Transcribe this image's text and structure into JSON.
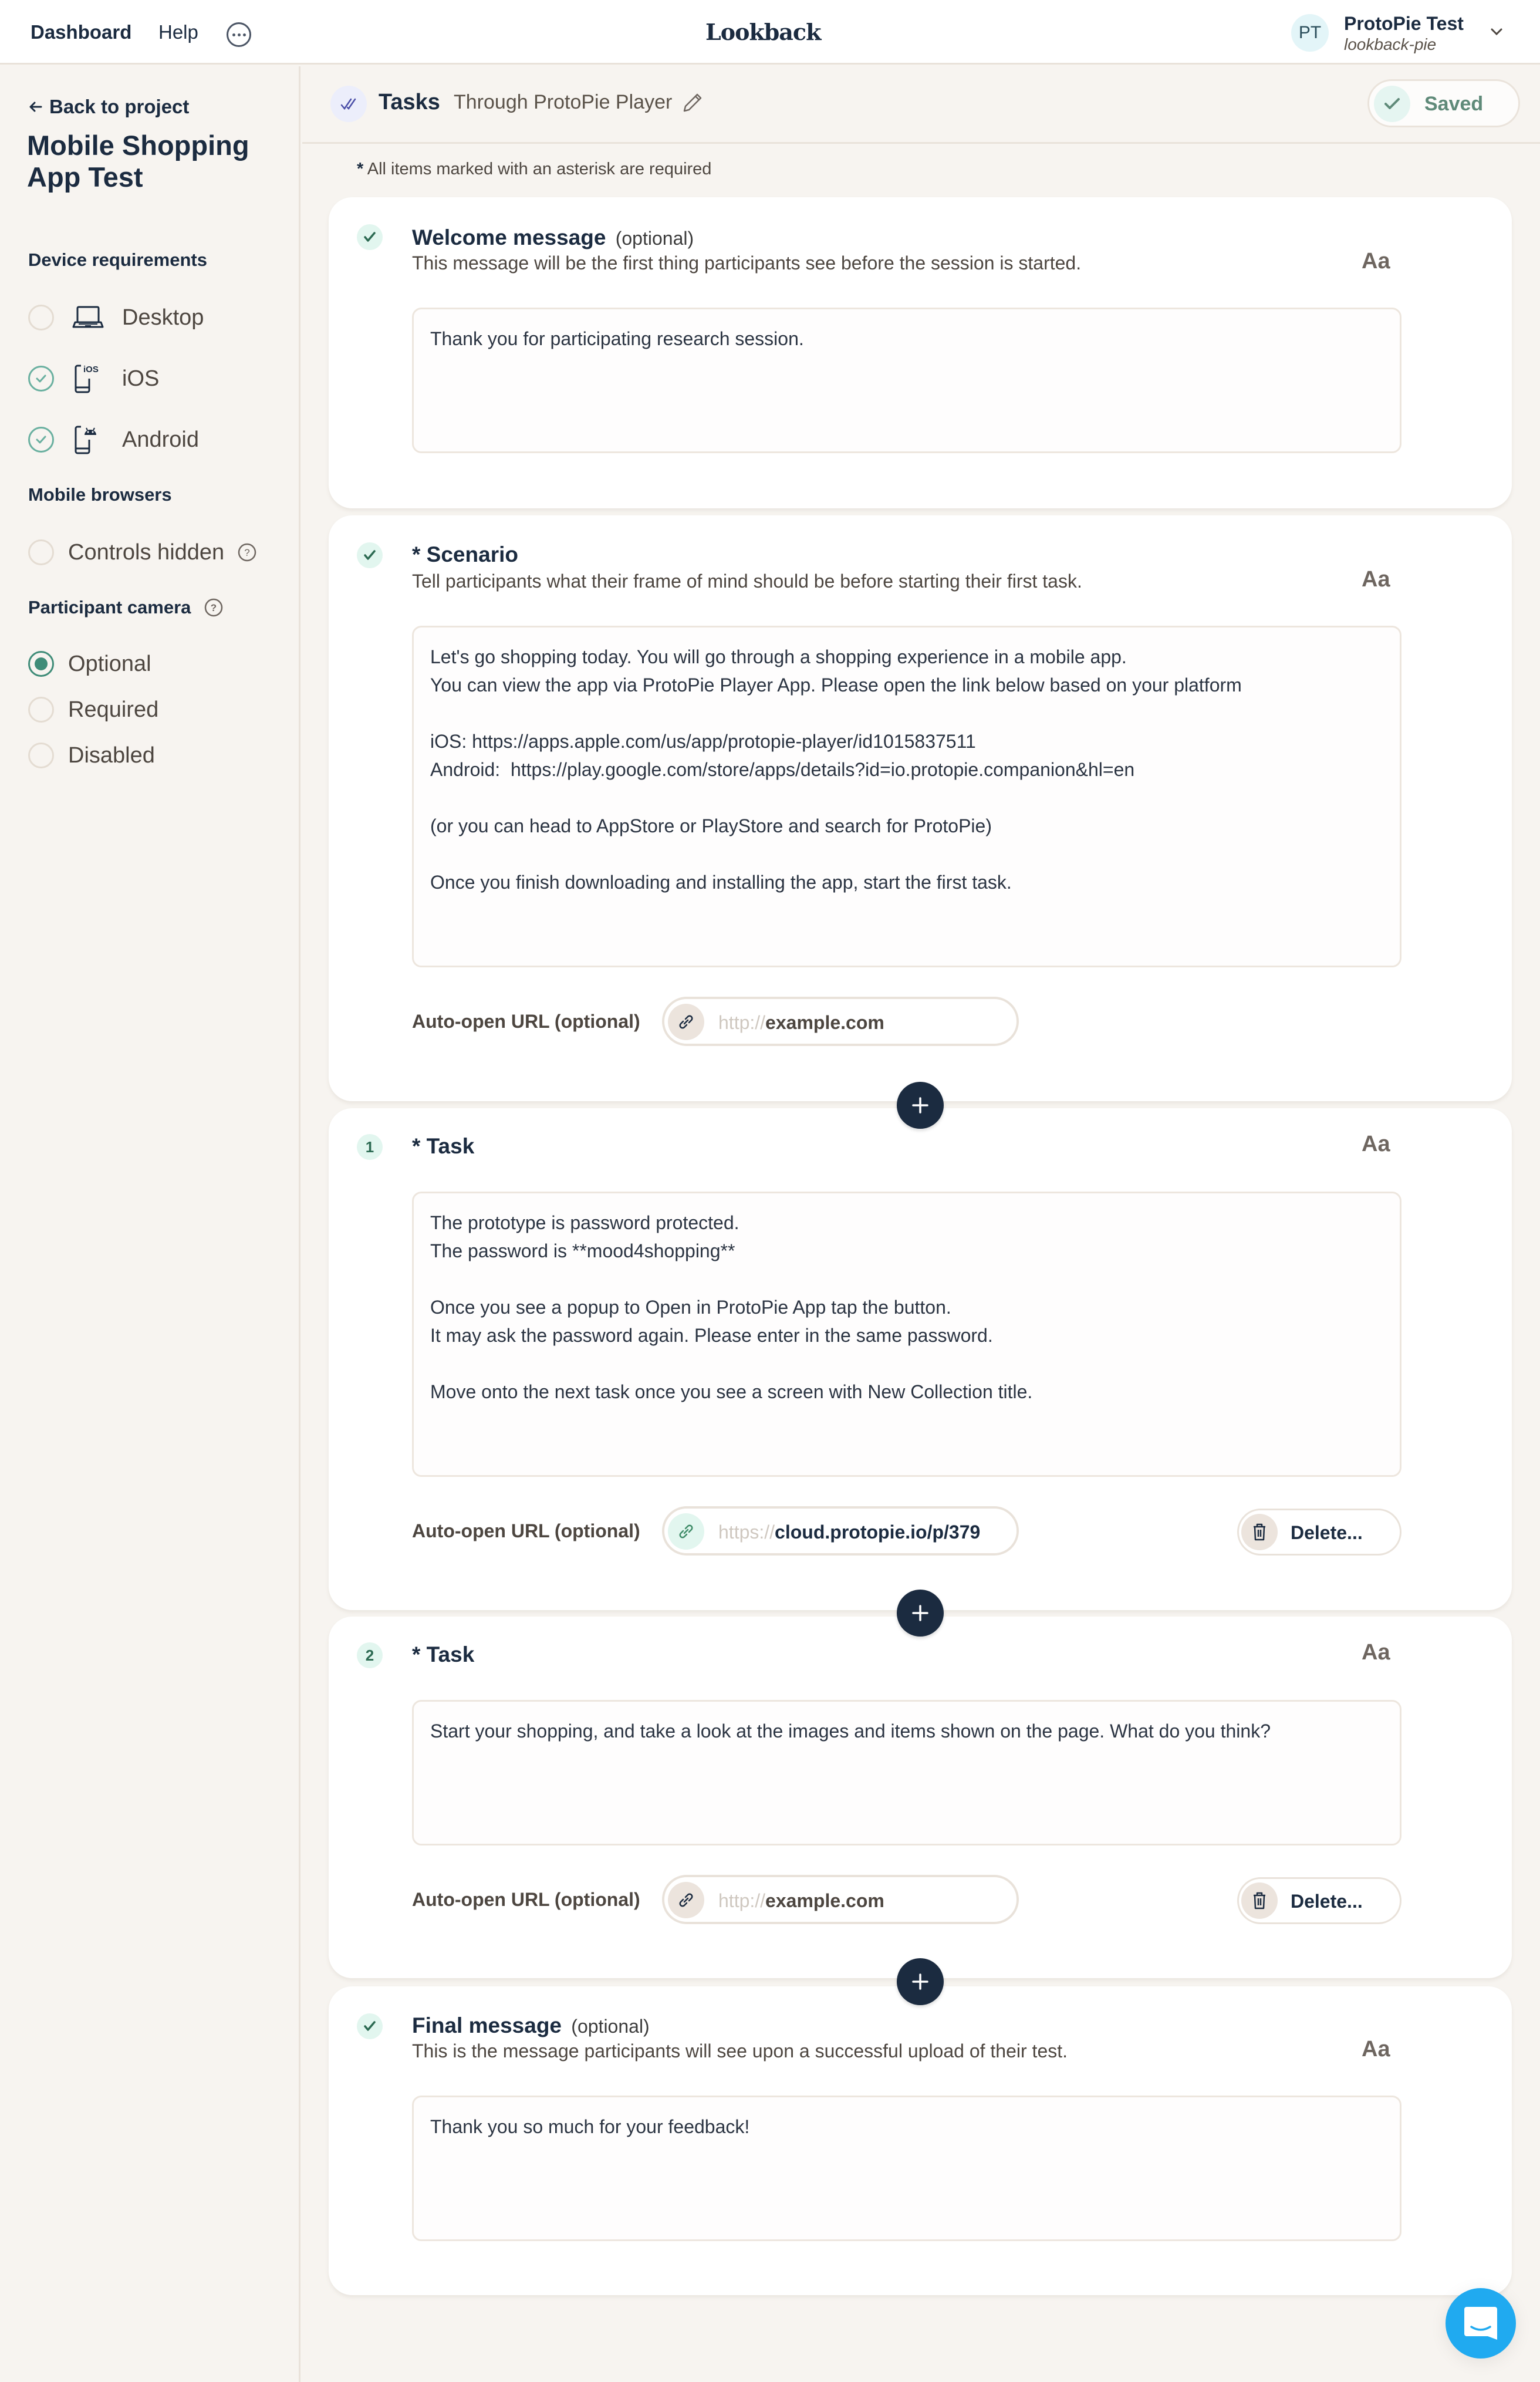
{
  "topbar": {
    "nav": {
      "dashboard": "Dashboard",
      "help": "Help"
    },
    "logo": "Lookback",
    "account": {
      "initials": "PT",
      "name": "ProtoPie Test",
      "org": "lookback-pie"
    }
  },
  "sidebar": {
    "back_label": "Back to project",
    "project_title": "Mobile Shopping App Test",
    "device_requirements": {
      "heading": "Device requirements",
      "items": [
        {
          "label": "Desktop",
          "icon": "laptop-icon",
          "checked": false
        },
        {
          "label": "iOS",
          "icon": "ios-phone-icon",
          "checked": true
        },
        {
          "label": "Android",
          "icon": "android-phone-icon",
          "checked": true
        }
      ]
    },
    "mobile_browsers": {
      "heading": "Mobile browsers",
      "items": [
        {
          "label": "Controls hidden",
          "checked": false
        }
      ]
    },
    "participant_camera": {
      "heading": "Participant camera",
      "options": [
        "Optional",
        "Required",
        "Disabled"
      ],
      "selected": "Optional"
    }
  },
  "subheader": {
    "title": "Tasks",
    "subtitle": "Through ProtoPie Player",
    "status": "Saved"
  },
  "required_note": {
    "asterisk": "*",
    "text": "All items marked with an asterisk are required"
  },
  "cards": {
    "welcome": {
      "title": "Welcome message",
      "optional": "(optional)",
      "description": "This message will be the first thing participants see before the session is started.",
      "format_label": "Aa",
      "text": "Thank you for participating research session."
    },
    "scenario": {
      "title": "* Scenario",
      "description": "Tell participants what their frame of mind should be before starting their first task.",
      "format_label": "Aa",
      "text": "Let's go shopping today. You will go through a shopping experience in a mobile app.\nYou can view the app via ProtoPie Player App. Please open the link below based on your platform\n\niOS: https://apps.apple.com/us/app/protopie-player/id1015837511\nAndroid:  https://play.google.com/store/apps/details?id=io.protopie.companion&hl=en\n\n(or you can head to AppStore or PlayStore and search for ProtoPie)\n\nOnce you finish downloading and installing the app, start the first task.",
      "url_label": "Auto-open URL (optional)",
      "url_protocol": "http://",
      "url_host": "example.com"
    },
    "tasks": [
      {
        "number": "1",
        "title": "* Task",
        "format_label": "Aa",
        "text": "The prototype is password protected.\nThe password is **mood4shopping**\n\nOnce you see a popup to Open in ProtoPie App tap the button.\nIt may ask the password again. Please enter in the same password.\n\nMove onto the next task once you see a screen with New Collection title.",
        "url_label": "Auto-open URL (optional)",
        "url_protocol": "https://",
        "url_host": "cloud.protopie.io/p/379",
        "delete_label": "Delete..."
      },
      {
        "number": "2",
        "title": "* Task",
        "format_label": "Aa",
        "text": "Start your shopping, and take a look at the images and items shown on the page. What do you think?",
        "url_label": "Auto-open URL (optional)",
        "url_protocol": "http://",
        "url_host": "example.com",
        "delete_label": "Delete..."
      }
    ],
    "final": {
      "title": "Final message",
      "optional": "(optional)",
      "description": "This is the message participants will see upon a successful upload of their test.",
      "format_label": "Aa",
      "text": "Thank you so much for your feedback!"
    }
  },
  "colors": {
    "navy": "#1b2b40",
    "accent_green": "#3f8c78",
    "background": "#f7f4f0",
    "chat_blue": "#20aaf0",
    "tasks_icon": "#4b4fa8"
  }
}
